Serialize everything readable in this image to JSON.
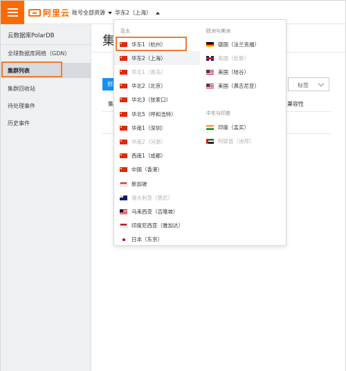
{
  "logo": {
    "text": "阿里云"
  },
  "topnav": {
    "resources": "账号全部资源",
    "region": "华东2（上海）"
  },
  "sidebar": {
    "title": "云数据库PolarDB",
    "items": [
      {
        "label": "全球数据库网络（GDN）"
      },
      {
        "label": "集群列表"
      },
      {
        "label": "集群回收站"
      },
      {
        "label": "待处理事件"
      },
      {
        "label": "历史事件"
      }
    ]
  },
  "main": {
    "title": "集",
    "create_label": "创",
    "tag_placeholder": "标签",
    "col_first": "集",
    "col_compat": "兼容性"
  },
  "dropdown": {
    "groups": {
      "asia": "亚太",
      "europe": "欧洲与美洲",
      "middle_east": "中东与印度"
    },
    "asia": [
      {
        "label": "华东1（杭州）",
        "flag": "cn",
        "disabled": false
      },
      {
        "label": "华东2（上海）",
        "flag": "cn",
        "disabled": false
      },
      {
        "label": "华北1（青岛）",
        "flag": "cn",
        "disabled": true
      },
      {
        "label": "华北2（北京）",
        "flag": "cn",
        "disabled": false
      },
      {
        "label": "华北3（张家口）",
        "flag": "cn",
        "disabled": false
      },
      {
        "label": "华北5（呼和浩特）",
        "flag": "cn",
        "disabled": false
      },
      {
        "label": "华南1（深圳）",
        "flag": "cn",
        "disabled": false
      },
      {
        "label": "华南2（河源）",
        "flag": "cn",
        "disabled": true
      },
      {
        "label": "西南1（成都）",
        "flag": "cn",
        "disabled": false
      },
      {
        "label": "中国（香港）",
        "flag": "cn",
        "disabled": false
      },
      {
        "label": "新加坡",
        "flag": "sg",
        "disabled": false
      },
      {
        "label": "澳大利亚（悉尼）",
        "flag": "au",
        "disabled": true
      },
      {
        "label": "马来西亚（吉隆坡）",
        "flag": "my",
        "disabled": false
      },
      {
        "label": "印度尼西亚（雅加达）",
        "flag": "id",
        "disabled": false
      },
      {
        "label": "日本（东京）",
        "flag": "jp",
        "disabled": false
      }
    ],
    "europe": [
      {
        "label": "德国（法兰克福）",
        "flag": "de",
        "disabled": false
      },
      {
        "label": "英国（伦敦）",
        "flag": "gb",
        "disabled": true
      },
      {
        "label": "美国（硅谷）",
        "flag": "us",
        "disabled": false
      },
      {
        "label": "美国（弗吉尼亚）",
        "flag": "us",
        "disabled": false
      }
    ],
    "middle_east": [
      {
        "label": "印度（孟买）",
        "flag": "in",
        "disabled": false
      },
      {
        "label": "阿联酋（迪拜）",
        "flag": "ae",
        "disabled": true
      }
    ]
  },
  "colors": {
    "brand": "#ff6a00",
    "highlight": "#f07b30",
    "primary_button": "#1a8ff2"
  }
}
